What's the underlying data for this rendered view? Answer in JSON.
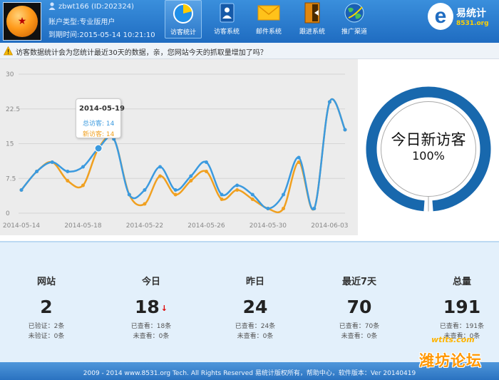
{
  "user": {
    "name": "zbwt166 (ID:202324)",
    "account_type": "账户类型:专业版用户",
    "expire_time": "到期时间:2015-05-14 10:21:10"
  },
  "nav": [
    {
      "label": "访客统计",
      "icon": "visitor-stats-icon"
    },
    {
      "label": "访客系统",
      "icon": "visitor-system-icon"
    },
    {
      "label": "邮件系统",
      "icon": "mail-icon"
    },
    {
      "label": "跟进系统",
      "icon": "follow-up-icon"
    },
    {
      "label": "推广渠道",
      "icon": "promotion-globe-icon"
    }
  ],
  "logo": {
    "letter": "e",
    "text": "易统计",
    "url": "8531.org"
  },
  "notice": "访客数据统计会为您统计最近30天的数据，亲，您网站今天的抓取量增加了吗？",
  "tooltip": {
    "date": "2014-05-19",
    "total": "总访客: 14",
    "new": "新访客: 14"
  },
  "chart_data": {
    "type": "line",
    "x": [
      "2014-05-14",
      "2014-05-15",
      "2014-05-16",
      "2014-05-17",
      "2014-05-18",
      "2014-05-19",
      "2014-05-20",
      "2014-05-21",
      "2014-05-22",
      "2014-05-23",
      "2014-05-24",
      "2014-05-25",
      "2014-05-26",
      "2014-05-27",
      "2014-05-28",
      "2014-05-29",
      "2014-05-30",
      "2014-05-31",
      "2014-06-01",
      "2014-06-02",
      "2014-06-03",
      "2014-06-04"
    ],
    "x_tick_labels": [
      "2014-05-14",
      "2014-05-18",
      "2014-05-22",
      "2014-05-26",
      "2014-05-30",
      "2014-06-03"
    ],
    "y_ticks": [
      "0",
      "7.5",
      "15",
      "22.5",
      "30"
    ],
    "ylim": [
      0,
      30
    ],
    "grid": true,
    "series": [
      {
        "color": "#3b9adf",
        "values": [
          5,
          9,
          11,
          9,
          10,
          14,
          16,
          4,
          5,
          10,
          5,
          8,
          11,
          4,
          6,
          4,
          1,
          4,
          12,
          1,
          24,
          18
        ]
      },
      {
        "color": "#f0a020",
        "values": [
          5,
          9,
          11,
          7,
          6,
          14,
          16,
          4,
          2,
          8,
          4,
          7,
          9,
          3,
          5,
          3,
          1,
          1,
          11,
          1,
          24,
          18
        ]
      }
    ]
  },
  "donut": {
    "title": "今日新访客",
    "percent": "100%",
    "value": 1.0,
    "color": "#1868ad"
  },
  "stats": [
    {
      "label": "网站",
      "value": "2",
      "line1": "已验证：2条",
      "line2": "未验证：0条",
      "arrow": ""
    },
    {
      "label": "今日",
      "value": "18",
      "line1": "已查看：18条",
      "line2": "未查看：0条",
      "arrow": "↓"
    },
    {
      "label": "昨日",
      "value": "24",
      "line1": "已查看：24条",
      "line2": "未查看：0条",
      "arrow": ""
    },
    {
      "label": "最近7天",
      "value": "70",
      "line1": "已查看：70条",
      "line2": "未查看：0条",
      "arrow": ""
    },
    {
      "label": "总量",
      "value": "191",
      "line1": "已查看：191条",
      "line2": "未查看：0条",
      "arrow": ""
    }
  ],
  "footer": "2009 - 2014 www.8531.org Tech. All Rights Reserved 易统计版权所有，帮助中心，软件版本：Ver 20140419",
  "watermark": {
    "url": "wtits.com",
    "name": "潍坊论坛"
  }
}
